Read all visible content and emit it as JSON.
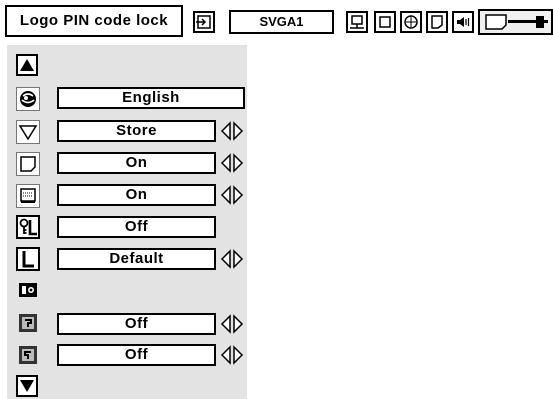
{
  "header": {
    "title": "Logo PIN code lock",
    "input_value": "SVGA1",
    "icons": [
      "input-icon",
      "pc-adjust-icon",
      "image-select-icon",
      "image-adjust-icon",
      "screen-icon",
      "sound-icon",
      "setting-icon"
    ]
  },
  "menu": {
    "scroll_up_icon": "up-arrow-icon",
    "scroll_down_icon": "down-arrow-icon",
    "rows": [
      {
        "icon": "language-globe-icon",
        "value": "English",
        "has_arrows": false
      },
      {
        "icon": "menu-position-icon",
        "value": "Store",
        "has_arrows": true
      },
      {
        "icon": "display-icon",
        "value": "On",
        "has_arrows": true
      },
      {
        "icon": "logo-icon",
        "value": "On",
        "has_arrows": true
      },
      {
        "icon": "logo-pin-lock-icon",
        "value": "Off",
        "has_arrows": false
      },
      {
        "icon": "l-icon",
        "value": "Default",
        "has_arrows": true
      },
      {
        "icon": "capture-camera-icon",
        "value": "",
        "has_arrows": false
      },
      {
        "icon": "ceiling-icon",
        "value": "Off",
        "has_arrows": true
      },
      {
        "icon": "rear-icon",
        "value": "Off",
        "has_arrows": true
      }
    ]
  },
  "colors": {
    "menu_bg": "#e3e3e3",
    "border": "#000000",
    "background": "#ffffff"
  }
}
